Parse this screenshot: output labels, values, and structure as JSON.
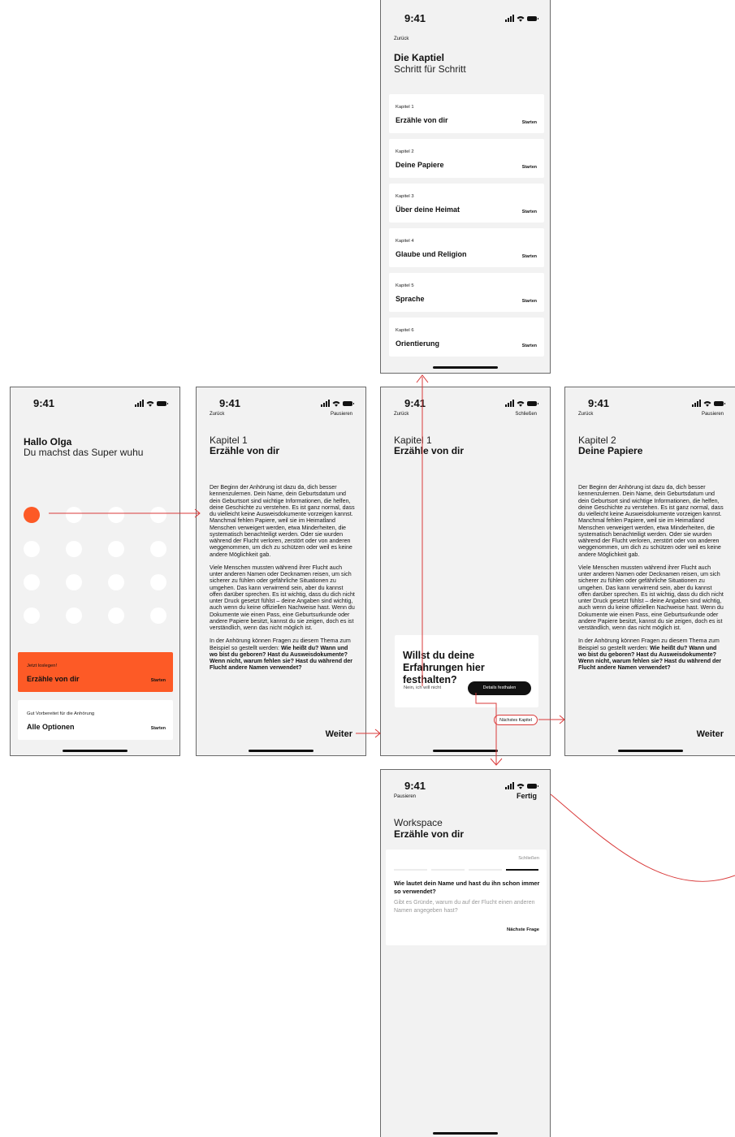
{
  "colors": {
    "accent": "#fd5a26",
    "link": "#d93a3a",
    "screen": "#f2f2f2",
    "card": "#ffffff",
    "dark": "#111111"
  },
  "status": {
    "time": "9:41",
    "icons": [
      "signal-icon",
      "wifi-icon",
      "battery-icon"
    ]
  },
  "chapters_screen": {
    "back": "Zurück",
    "title": "Die Kaptiel",
    "subtitle": "Schritt für Schritt",
    "chapters": [
      {
        "label": "Kapitel 1",
        "title": "Erzähle von dir",
        "action": "Starten"
      },
      {
        "label": "Kapitel 2",
        "title": "Deine Papiere",
        "action": "Starten"
      },
      {
        "label": "Kapitel 3",
        "title": "Über deine Heimat",
        "action": "Starten"
      },
      {
        "label": "Kapitel 4",
        "title": "Glaube und Religion",
        "action": "Starten"
      },
      {
        "label": "Kapitel 5",
        "title": "Sprache",
        "action": "Starten"
      },
      {
        "label": "Kapitel 6",
        "title": "Orientierung",
        "action": "Starten"
      }
    ]
  },
  "home_screen": {
    "greeting": "Hallo Olga",
    "subtitle": "Du machst das Super wuhu",
    "progress": {
      "completed": 1,
      "total": 16
    },
    "current_card": {
      "label": "Jetzt loslegen!",
      "title": "Erzähle von dir",
      "action": "Starten"
    },
    "options_card": {
      "label": "Gut Vorbereitet für die Anhörung",
      "title": "Alle Optionen",
      "action": "Starten"
    }
  },
  "chapter1_screen": {
    "back": "Zurück",
    "pause": "Pausieren",
    "label": "Kapitel 1",
    "title": "Erzähle von dir",
    "paragraph1": "Der Beginn der Anhörung ist dazu da, dich besser kennenzulernen. Dein Name, dein Geburtsdatum und dein Geburtsort sind wichtige Informationen, die helfen, deine Geschichte zu verstehen. Es ist ganz normal, dass du vielleicht keine Ausweisdokumente vorzeigen kannst. Manchmal fehlen Papiere, weil sie im Heimatland Menschen verweigert werden, etwa Minderheiten, die systematisch benachteiligt werden. Oder sie wurden während der Flucht verloren, zerstört oder von anderen weggenommen, um dich zu schützen oder weil es keine andere Möglichkeit gab.",
    "paragraph2": "Viele Menschen mussten während ihrer Flucht auch unter anderen Namen oder Decknamen reisen, um sich sicherer zu fühlen oder gefährliche Situationen zu umgehen. Das kann verwirrend sein, aber du kannst offen darüber sprechen. Es ist wichtig, dass du dich nicht unter Druck gesetzt fühlst – deine Angaben sind wichtig, auch wenn du keine offiziellen Nachweise hast. Wenn du Dokumente wie einen Pass, eine Geburtsurkunde oder andere Papiere besitzt, kannst du sie zeigen, doch es ist verständlich, wenn das nicht möglich ist.",
    "paragraph3_intro": "In der Anhörung können Fragen zu diesem Thema zum Beispiel so gestellt werden: ",
    "paragraph3_bold": "Wie heißt du? Wann und wo bist du geboren? Hast du Ausweisdokumente? Wenn nicht, warum fehlen sie? Hast du während der Flucht andere Namen verwendet?",
    "next": "Weiter"
  },
  "record_screen": {
    "back": "Zurück",
    "close": "Schließen",
    "label": "Kapitel 1",
    "title": "Erzähle von dir",
    "dialog_title": "Willst du deine Erfahrungen hier festhalten?",
    "decline": "Nein, ich will nicht",
    "confirm": "Details festhalen",
    "next_chapter": "Nächstes Kapitel"
  },
  "chapter2_screen": {
    "back": "Zurück",
    "pause": "Pausieren",
    "label": "Kapitel 2",
    "title": "Deine Papiere",
    "paragraph1": "Der Beginn der Anhörung ist dazu da, dich besser kennenzulernen. Dein Name, dein Geburtsdatum und dein Geburtsort sind wichtige Informationen, die helfen, deine Geschichte zu verstehen. Es ist ganz normal, dass du vielleicht keine Ausweisdokumente vorzeigen kannst. Manchmal fehlen Papiere, weil sie im Heimatland Menschen verweigert werden, etwa Minderheiten, die systematisch benachteiligt werden. Oder sie wurden während der Flucht verloren, zerstört oder von anderen weggenommen, um dich zu schützen oder weil es keine andere Möglichkeit gab.",
    "paragraph2": "Viele Menschen mussten während ihrer Flucht auch unter anderen Namen oder Decknamen reisen, um sich sicherer zu fühlen oder gefährliche Situationen zu umgehen. Das kann verwirrend sein, aber du kannst offen darüber sprechen. Es ist wichtig, dass du dich nicht unter Druck gesetzt fühlst – deine Angaben sind wichtig, auch wenn du keine offiziellen Nachweise hast. Wenn du Dokumente wie einen Pass, eine Geburtsurkunde oder andere Papiere besitzt, kannst du sie zeigen, doch es ist verständlich, wenn das nicht möglich ist.",
    "paragraph3_intro": "In der Anhörung können Fragen zu diesem Thema zum Beispiel so gestellt werden: ",
    "paragraph3_bold": "Wie heißt du? Wann und wo bist du geboren? Hast du Ausweisdokumente? Wenn nicht, warum fehlen sie? Hast du während der Flucht andere Namen verwendet?",
    "next": "Weiter"
  },
  "workspace_screen": {
    "pause": "Pausieren",
    "done": "Fertig",
    "label": "Workspace",
    "title": "Erzähle von dir",
    "close": "Schließen",
    "progress": {
      "step": 4,
      "total": 4
    },
    "question": "Wie lautet dein Name und hast du ihn schon immer so verwendet?",
    "hint": "Gibt es Gründe, warum du auf der Flucht einen anderen Namen angegeben hast?",
    "next_question": "Nächste Frage"
  }
}
